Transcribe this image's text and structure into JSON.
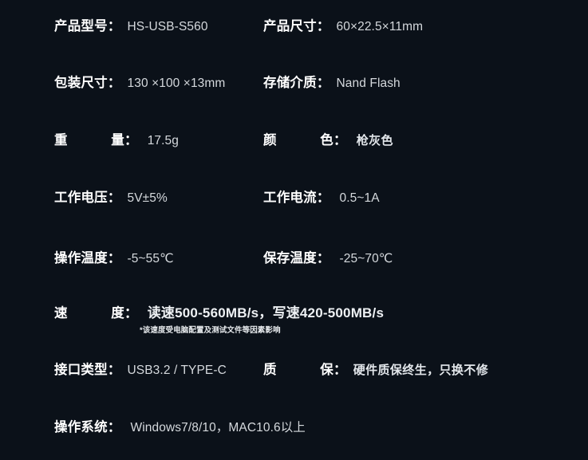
{
  "theme": {
    "background": "#0b1119",
    "label_color": "#ffffff",
    "value_color": "#d5d9dd",
    "note_color": "#e8ebee"
  },
  "specs": {
    "model": {
      "label": "产品型号",
      "colon": "：",
      "value": "HS-USB-S560"
    },
    "dimensions": {
      "label": "产品尺寸",
      "colon": "：",
      "value": "60×22.5×11mm"
    },
    "package_size": {
      "label": "包装尺寸",
      "colon": "：",
      "value": "130 ×100 ×13mm"
    },
    "storage_medium": {
      "label": "存储介质",
      "colon": "：",
      "value": "Nand Flash"
    },
    "weight": {
      "label": "重 量",
      "colon": "：",
      "value": "17.5g"
    },
    "color": {
      "label": "颜 色",
      "colon": "：",
      "value": "枪灰色"
    },
    "voltage": {
      "label": "工作电压",
      "colon": "：",
      "value": "5V±5%"
    },
    "current": {
      "label": "工作电流",
      "colon": "：",
      "value": "0.5~1A"
    },
    "operating_temp": {
      "label": "操作温度",
      "colon": "：",
      "value": "-5~55℃"
    },
    "storage_temp": {
      "label": "保存温度",
      "colon": "：",
      "value": "-25~70℃"
    },
    "speed": {
      "label": "速 度",
      "colon": "：",
      "value": "读速500-560MB/s，写速420-500MB/s",
      "note": "*该速度受电脑配置及测试文件等因素影响"
    },
    "interface": {
      "label": "接口类型",
      "colon": "：",
      "value": "USB3.2 / TYPE-C"
    },
    "warranty": {
      "label": "质 保",
      "colon": "：",
      "value": "硬件质保终生，只换不修"
    },
    "os": {
      "label": "操作系统",
      "colon": "：",
      "value": "Windows7/8/10，MAC10.6以上"
    }
  }
}
